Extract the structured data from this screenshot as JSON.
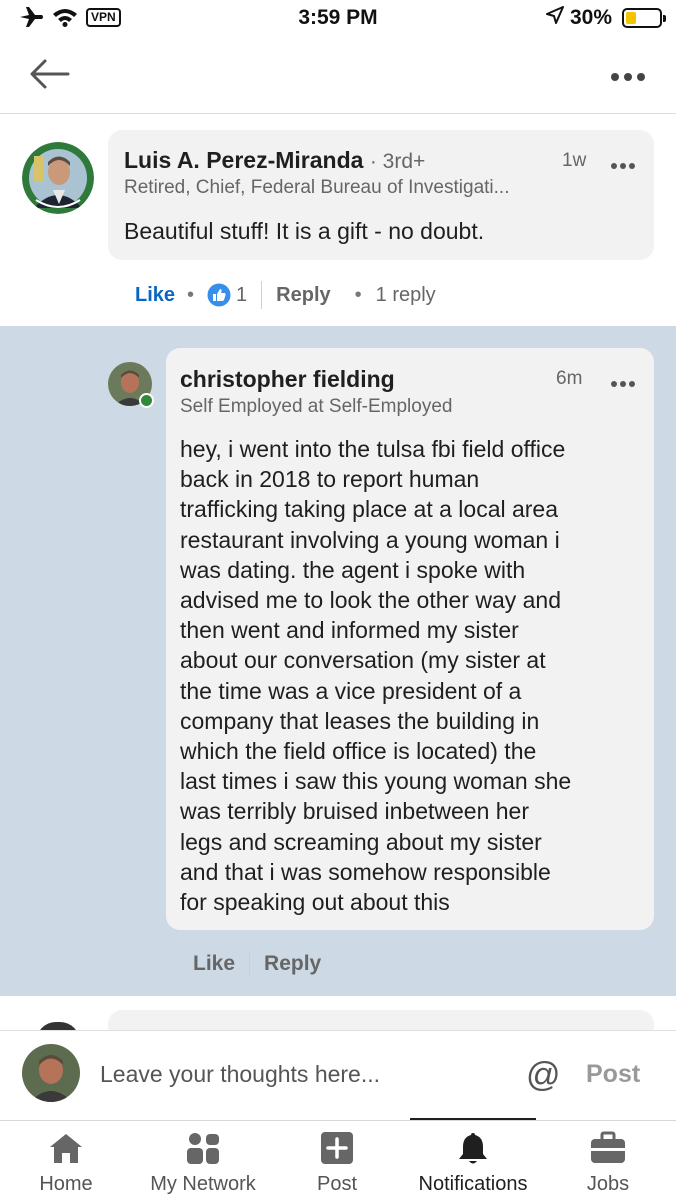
{
  "status_bar": {
    "vpn": "VPN",
    "time": "3:59 PM",
    "battery": "30%",
    "battery_level": 0.3
  },
  "header": {
    "back_icon": "arrow-left-icon",
    "more_icon": "ellipsis-icon"
  },
  "comment": {
    "author": "Luis A. Perez-Miranda",
    "degree": "· 3rd+",
    "headline": "Retired, Chief, Federal Bureau of Investigati...",
    "time": "1w",
    "text": "Beautiful stuff! It is a gift - no doubt.",
    "like_label": "Like",
    "reaction_count": "1",
    "reply_label": "Reply",
    "replies_label": "1 reply"
  },
  "reply": {
    "author": "christopher fielding",
    "headline": "Self Employed at Self-Employed",
    "time": "6m",
    "lines": [
      "hey, i went into the tulsa fbi field office",
      "back in 2018 to report human",
      "trafficking taking place at a local area",
      "restaurant involving a young woman i",
      "was dating. the agent i spoke with",
      "advised me to look the other way and",
      "then went and informed my sister",
      "about our conversation (my sister at",
      "the time was a vice president of a",
      "company that leases the building in",
      "which the field office is located) the",
      "last times i saw this young woman she",
      "was terribly bruised inbetween her",
      "legs and screaming about my sister",
      "and that i was somehow responsible",
      "for speaking out about this"
    ],
    "like_label": "Like",
    "reply_label": "Reply"
  },
  "compose": {
    "placeholder": "Leave your thoughts here...",
    "mention_label": "@",
    "post_label": "Post"
  },
  "tabs": [
    {
      "label": "Home",
      "icon": "home-icon"
    },
    {
      "label": "My Network",
      "icon": "network-icon"
    },
    {
      "label": "Post",
      "icon": "plus-square-icon"
    },
    {
      "label": "Notifications",
      "icon": "bell-icon",
      "active": true
    },
    {
      "label": "Jobs",
      "icon": "briefcase-icon"
    }
  ],
  "colors": {
    "accent": "#0a66c2",
    "reply_highlight": "#cdd9e4",
    "bubble": "#f2f2f2",
    "online": "#2e8a3a"
  }
}
